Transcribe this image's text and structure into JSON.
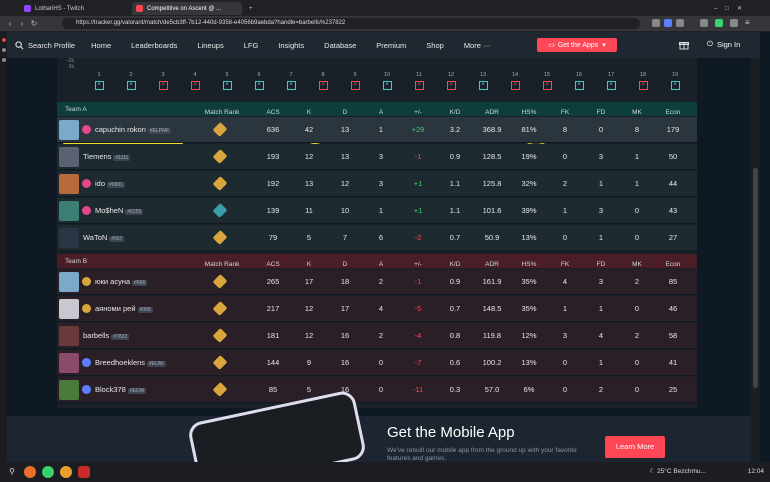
{
  "browser": {
    "tabs": [
      {
        "title": "LothariHS - Twitch",
        "color": "#9147ff"
      },
      {
        "title": "Competitive on Ascent @ ...",
        "color": "#ff4655"
      }
    ],
    "url": "https://tracker.gg/valorant/match/de5cb3ff-7b12-440d-9358-e4056b9aebda?handle=barbells%237822"
  },
  "nav": {
    "search": "Search Profile",
    "items": [
      "Home",
      "Leaderboards",
      "Lineups",
      "LFG",
      "Insights",
      "Database",
      "Premium",
      "Shop",
      "More ···"
    ],
    "get_apps": "Get the Apps",
    "sign_in": "Sign In"
  },
  "rounds": {
    "score_labels": [
      "-2k",
      "-3k"
    ],
    "numbers": [
      "1",
      "2",
      "3",
      "4",
      "5",
      "6",
      "7",
      "8",
      "9",
      "10",
      "11",
      "12",
      "13",
      "14",
      "15",
      "16",
      "17",
      "18",
      "19"
    ],
    "red": [
      3,
      4,
      8,
      9,
      11,
      12,
      14,
      15,
      18
    ]
  },
  "headers": [
    "Match Rank",
    "ACS",
    "K",
    "D",
    "A",
    "+/-",
    "K/D",
    "ADR",
    "HS%",
    "FK",
    "FD",
    "MK",
    "Econ"
  ],
  "team_a": {
    "label": "Team A",
    "players": [
      {
        "name": "capuchin rokon",
        "tag": "#ELPMF",
        "rank": "gold",
        "acs": "636",
        "k": "42",
        "d": "13",
        "a": "1",
        "pm": "+29",
        "kd": "3.2",
        "adr": "368.9",
        "hs": "81%",
        "fk": "8",
        "fd": "0",
        "mk": "8",
        "econ": "179",
        "agent_color": "#7aa9c9",
        "lvl_color": "#e4478c"
      },
      {
        "name": "Tiemens",
        "tag": "#1111",
        "rank": "gold",
        "acs": "193",
        "k": "12",
        "d": "13",
        "a": "3",
        "pm": "-1",
        "kd": "0.9",
        "adr": "128.5",
        "hs": "19%",
        "fk": "0",
        "fd": "3",
        "mk": "1",
        "econ": "50",
        "agent_color": "#5a6170",
        "lvl_color": ""
      },
      {
        "name": "ido",
        "tag": "#0901",
        "rank": "gold",
        "acs": "192",
        "k": "13",
        "d": "12",
        "a": "3",
        "pm": "+1",
        "kd": "1.1",
        "adr": "125.8",
        "hs": "32%",
        "fk": "2",
        "fd": "1",
        "mk": "1",
        "econ": "44",
        "agent_color": "#b86a3c",
        "lvl_color": "#e4478c"
      },
      {
        "name": "Mo$heN",
        "tag": "#6255",
        "rank": "plat",
        "acs": "139",
        "k": "11",
        "d": "10",
        "a": "1",
        "pm": "+1",
        "kd": "1.1",
        "adr": "101.6",
        "hs": "39%",
        "fk": "1",
        "fd": "3",
        "mk": "0",
        "econ": "43",
        "agent_color": "#3a7e74",
        "lvl_color": "#e4478c"
      },
      {
        "name": "WaToN",
        "tag": "#557",
        "rank": "gold",
        "acs": "79",
        "k": "5",
        "d": "7",
        "a": "6",
        "pm": "-2",
        "kd": "0.7",
        "adr": "50.9",
        "hs": "13%",
        "fk": "0",
        "fd": "1",
        "mk": "0",
        "econ": "27",
        "agent_color": "#2c3545",
        "lvl_color": ""
      }
    ]
  },
  "team_b": {
    "label": "Team B",
    "players": [
      {
        "name": "юки асуна",
        "tag": "#666",
        "rank": "gold",
        "acs": "265",
        "k": "17",
        "d": "18",
        "a": "2",
        "pm": "-1",
        "kd": "0.9",
        "adr": "161.9",
        "hs": "35%",
        "fk": "4",
        "fd": "3",
        "mk": "2",
        "econ": "85",
        "agent_color": "#7aa9c9",
        "lvl_color": "#d8a63c"
      },
      {
        "name": "аяноми рей",
        "tag": "#000",
        "rank": "gold",
        "acs": "217",
        "k": "12",
        "d": "17",
        "a": "4",
        "pm": "-5",
        "kd": "0.7",
        "adr": "148.5",
        "hs": "35%",
        "fk": "1",
        "fd": "1",
        "mk": "0",
        "econ": "46",
        "agent_color": "#c8c8d0",
        "lvl_color": "#d8a63c"
      },
      {
        "name": "barbells",
        "tag": "#7822",
        "rank": "gold",
        "acs": "181",
        "k": "12",
        "d": "16",
        "a": "2",
        "pm": "-4",
        "kd": "0.8",
        "adr": "119.8",
        "hs": "12%",
        "fk": "3",
        "fd": "4",
        "mk": "2",
        "econ": "58",
        "agent_color": "#6a3a3a",
        "lvl_color": ""
      },
      {
        "name": "Breedhoeklens",
        "tag": "#EUW",
        "rank": "gold",
        "acs": "144",
        "k": "9",
        "d": "16",
        "a": "0",
        "pm": "-7",
        "kd": "0.6",
        "adr": "100.2",
        "hs": "13%",
        "fk": "0",
        "fd": "1",
        "mk": "0",
        "econ": "41",
        "agent_color": "#8a4a6a",
        "lvl_color": "#5b7fff"
      },
      {
        "name": "Block378",
        "tag": "#EUW",
        "rank": "gold",
        "acs": "85",
        "k": "5",
        "d": "16",
        "a": "0",
        "pm": "-11",
        "kd": "0.3",
        "adr": "57.0",
        "hs": "6%",
        "fk": "0",
        "fd": "2",
        "mk": "0",
        "econ": "25",
        "agent_color": "#4a7a3a",
        "lvl_color": "#5b7fff"
      }
    ]
  },
  "promo": {
    "title": "Get the Mobile App",
    "desc": "We've rebuilt our mobile app from the ground up with your favorite features and games.",
    "cta": "Learn More"
  },
  "taskbar": {
    "weather": "25°C Bezchmu...",
    "time": "12:04"
  }
}
